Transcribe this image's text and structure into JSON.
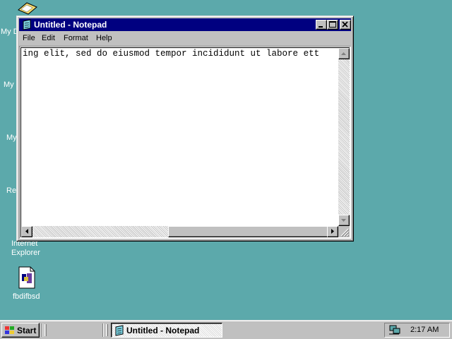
{
  "desktop": {
    "icons": [
      {
        "label": "My D"
      },
      {
        "label": "My"
      },
      {
        "label": "My"
      },
      {
        "label": "Re"
      },
      {
        "label_line1": "Internet",
        "label_line2": "Explorer"
      },
      {
        "label": "fbdifbsd"
      }
    ],
    "background_color": "#5ca9ab"
  },
  "window": {
    "title": "Untitled - Notepad",
    "title_icon": "notepad-icon",
    "controls": [
      "minimize-icon",
      "maximize-icon",
      "close-icon"
    ],
    "menu": [
      "File",
      "Edit",
      "Format",
      "Help"
    ],
    "text": "ing elit, sed do eiusmod tempor incididunt ut labore ett"
  },
  "taskbar": {
    "start_label": "Start",
    "task_label": "Untitled - Notepad",
    "clock": "2:17 AM",
    "tray_icon": "network-icon"
  }
}
